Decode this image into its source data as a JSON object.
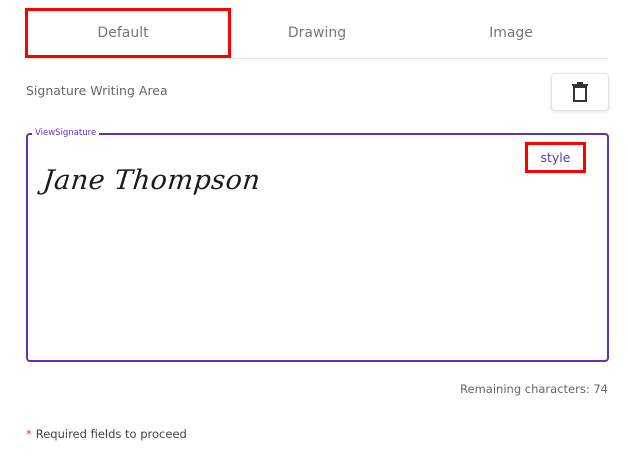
{
  "tabs": [
    {
      "label": "Default"
    },
    {
      "label": "Drawing"
    },
    {
      "label": "Image"
    }
  ],
  "signature_area": {
    "label": "Signature Writing Area",
    "clear_icon": "trash-icon",
    "field_legend": "ViewSignature",
    "signature_text": "Jane Thompson",
    "style_button_label": "style",
    "remaining_characters": "Remaining characters: 74"
  },
  "footer": {
    "required_marker": "*",
    "required_note": "Required fields to proceed"
  },
  "colors": {
    "accent": "#5b35b1",
    "highlight": "#ff0000",
    "required_star": "#e53935"
  }
}
